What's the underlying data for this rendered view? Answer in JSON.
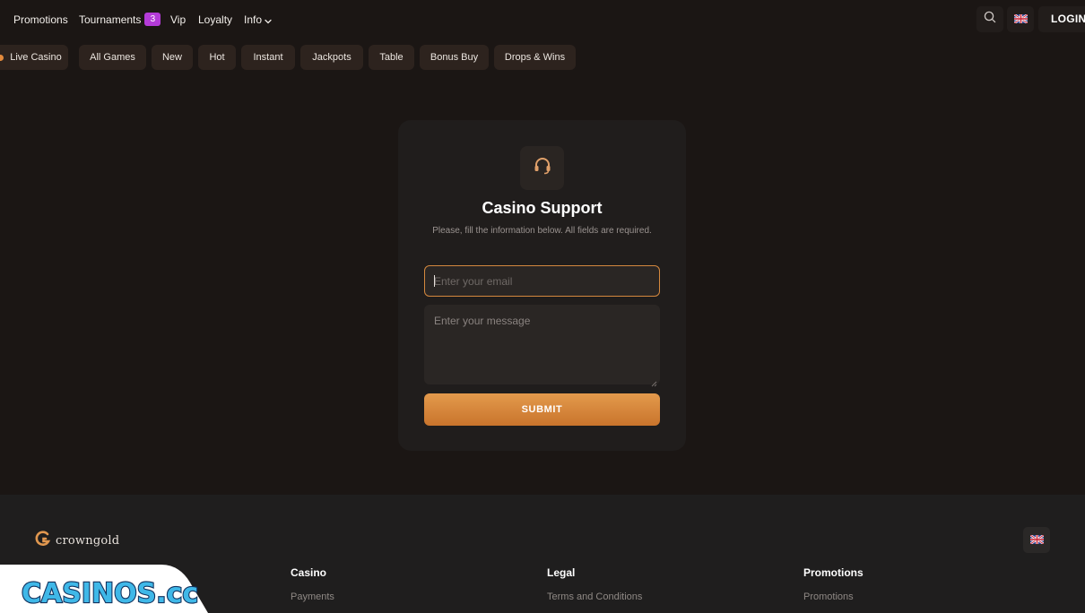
{
  "nav": {
    "items": [
      {
        "label": "Promotions"
      },
      {
        "label": "Tournaments",
        "badge": "3"
      },
      {
        "label": "Vip"
      },
      {
        "label": "Loyalty"
      },
      {
        "label": "Info"
      }
    ],
    "login_label": "LOGIN"
  },
  "chips": [
    "Live Casino",
    "All Games",
    "New",
    "Hot",
    "Instant",
    "Jackpots",
    "Table",
    "Bonus Buy",
    "Drops & Wins"
  ],
  "support": {
    "title": "Casino Support",
    "subtitle": "Please, fill the information below. All fields are required.",
    "email_placeholder": "Enter your email",
    "message_placeholder": "Enter your message",
    "submit_label": "SUBMIT"
  },
  "footer": {
    "brand": "crowngold",
    "columns": [
      {
        "heading": "Casino",
        "link": "Payments"
      },
      {
        "heading": "Legal",
        "link": "Terms and Conditions"
      },
      {
        "heading": "Promotions",
        "link": "Promotions"
      }
    ]
  },
  "watermark": {
    "text": "CASINOS.cc"
  },
  "colors": {
    "accent": "#d4883e",
    "badge": "#b43bd8",
    "background": "#1b1614",
    "card": "#201d1c",
    "chip": "#2d231e"
  }
}
